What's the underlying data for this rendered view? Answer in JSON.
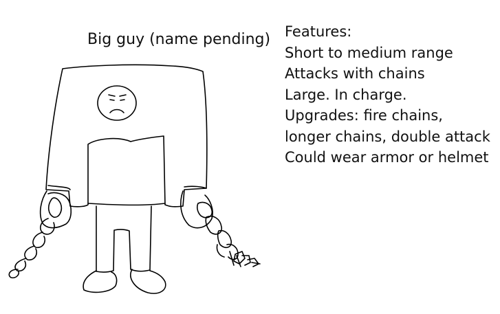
{
  "title": "Big guy (name pending)",
  "features": {
    "heading": "Features:",
    "items": [
      "Short to medium range",
      "Attacks with chains",
      "Large. In charge.",
      "Upgrades: fire chains,",
      "longer chains, double attack",
      "Could wear armor or helmet"
    ]
  },
  "colors": {
    "background": "#ffffff",
    "ink": "#000000"
  }
}
